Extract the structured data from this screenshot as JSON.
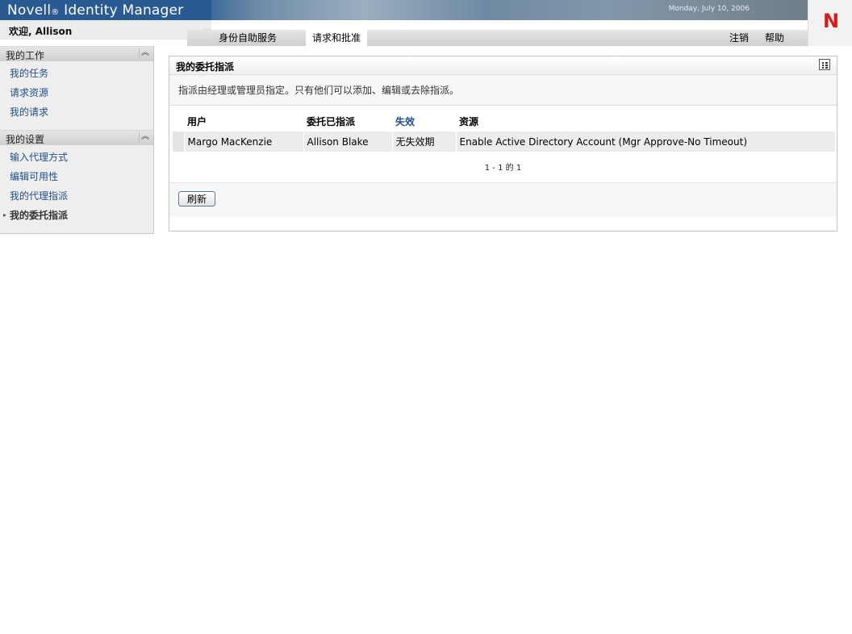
{
  "header": {
    "app_title_brand": "Novell",
    "app_title_reg": "®",
    "app_title_product": " Identity Manager",
    "date": "Monday, July 10, 2006",
    "logo_letter": "N",
    "welcome": "欢迎, Allison",
    "tabs": [
      {
        "label": "身份自助服务"
      },
      {
        "label": "请求和批准"
      }
    ],
    "logout_label": "注销",
    "help_label": "帮助"
  },
  "sidebar": {
    "sections": [
      {
        "title": "我的工作",
        "items": [
          {
            "label": "我的任务"
          },
          {
            "label": "请求资源"
          },
          {
            "label": "我的请求"
          }
        ]
      },
      {
        "title": "我的设置",
        "items": [
          {
            "label": "输入代理方式"
          },
          {
            "label": "编辑可用性"
          },
          {
            "label": "我的代理指派"
          },
          {
            "label": "我的委托指派"
          }
        ]
      }
    ],
    "collapse_glyph": "︽",
    "bullet_glyph": "▸"
  },
  "main": {
    "title": "我的委托指派",
    "description": "指派由经理或管理员指定。只有他们可以添加、编辑或去除指派。",
    "columns": [
      "用户",
      "委托已指派",
      "失效",
      "资源"
    ],
    "rows": [
      [
        "Margo MacKenzie",
        "Allison Blake",
        "无失效期",
        "Enable Active Directory Account (Mgr Approve-No Timeout)"
      ]
    ],
    "pager": "1 - 1 的 1",
    "refresh_label": "刷新"
  },
  "colors": {
    "brand_blue": "#2a5a92",
    "link_blue": "#1f4f86",
    "logo_red": "#d51b1b"
  }
}
